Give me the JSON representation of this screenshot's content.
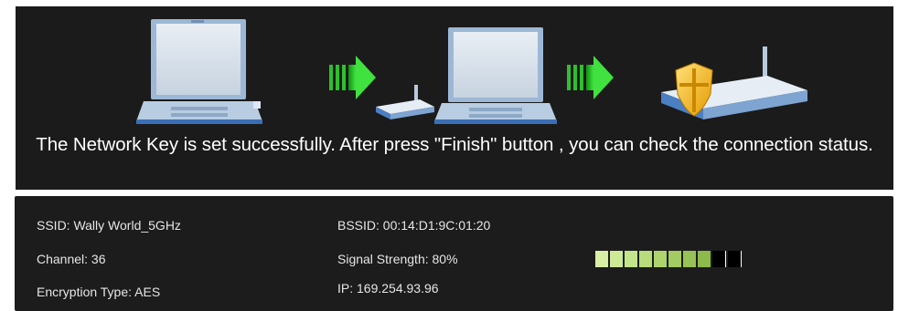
{
  "message": "The Network Key is set successfully. After press \"Finish\" button , you can check the connection status.",
  "status": {
    "ssid": "SSID: Wally World_5GHz",
    "channel": "Channel: 36",
    "encryption": "Encryption Type: AES",
    "bssid": "BSSID: 00:14:D1:9C:01:20",
    "signal": "Signal Strength: 80%",
    "ip": "IP: 169.254.93.96"
  },
  "signal_meter": {
    "level": 0.8,
    "segments": 10,
    "colors": [
      "#d7f0a4",
      "#cdea96",
      "#c3e48a",
      "#b8dc7c",
      "#aed46e",
      "#a3cb62",
      "#98c256",
      "#8dba4a",
      "#000000",
      "#000000"
    ]
  },
  "colors": {
    "panel": "#1b1b1b",
    "arrow": "#33d133"
  }
}
